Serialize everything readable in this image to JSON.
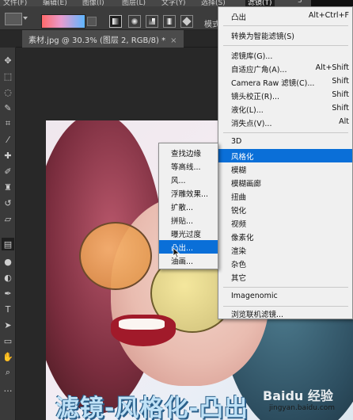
{
  "menubar": {
    "items": [
      "文件(F)",
      "编辑(E)",
      "图像(I)",
      "图层(L)",
      "文字(Y)",
      "选择(S)",
      "滤镜(T)",
      "3"
    ],
    "active_index": 6
  },
  "options_bar": {
    "mode_label": "模式"
  },
  "document_tab": {
    "title": "素材.jpg @ 30.3% (图层 2, RGB/8) *",
    "close": "×"
  },
  "filter_menu": {
    "items": [
      {
        "label": "凸出",
        "shortcut": "Alt+Ctrl+F"
      },
      {
        "label": "转换为智能滤镜(S)",
        "shortcut": ""
      },
      {
        "label": "滤镜库(G)...",
        "shortcut": ""
      },
      {
        "label": "自适应广角(A)...",
        "shortcut": "Alt+Shift"
      },
      {
        "label": "Camera Raw 滤镜(C)...",
        "shortcut": "Shift"
      },
      {
        "label": "镜头校正(R)...",
        "shortcut": "Shift"
      },
      {
        "label": "液化(L)...",
        "shortcut": "Shift"
      },
      {
        "label": "消失点(V)...",
        "shortcut": "Alt"
      },
      {
        "label": "3D",
        "shortcut": ""
      },
      {
        "label": "风格化",
        "shortcut": ""
      },
      {
        "label": "模糊",
        "shortcut": ""
      },
      {
        "label": "模糊画廊",
        "shortcut": ""
      },
      {
        "label": "扭曲",
        "shortcut": ""
      },
      {
        "label": "锐化",
        "shortcut": ""
      },
      {
        "label": "视频",
        "shortcut": ""
      },
      {
        "label": "像素化",
        "shortcut": ""
      },
      {
        "label": "渲染",
        "shortcut": ""
      },
      {
        "label": "杂色",
        "shortcut": ""
      },
      {
        "label": "其它",
        "shortcut": ""
      },
      {
        "label": "Imagenomic",
        "shortcut": ""
      },
      {
        "label": "浏览联机滤镜...",
        "shortcut": ""
      }
    ]
  },
  "stylize_submenu": {
    "items": [
      "查找边缘",
      "等高线...",
      "风...",
      "浮雕效果...",
      "扩散...",
      "拼贴...",
      "曝光过度",
      "凸出...",
      "油画..."
    ]
  },
  "caption": "滤镜-风格化-凸出",
  "watermark": {
    "brand": "Baidu 经验",
    "url": "jingyan.baidu.com"
  },
  "colors": {
    "menu_bg": "#f0f0f0",
    "highlight": "#0a6fd8",
    "ui_dark": "#3c3c3c"
  }
}
